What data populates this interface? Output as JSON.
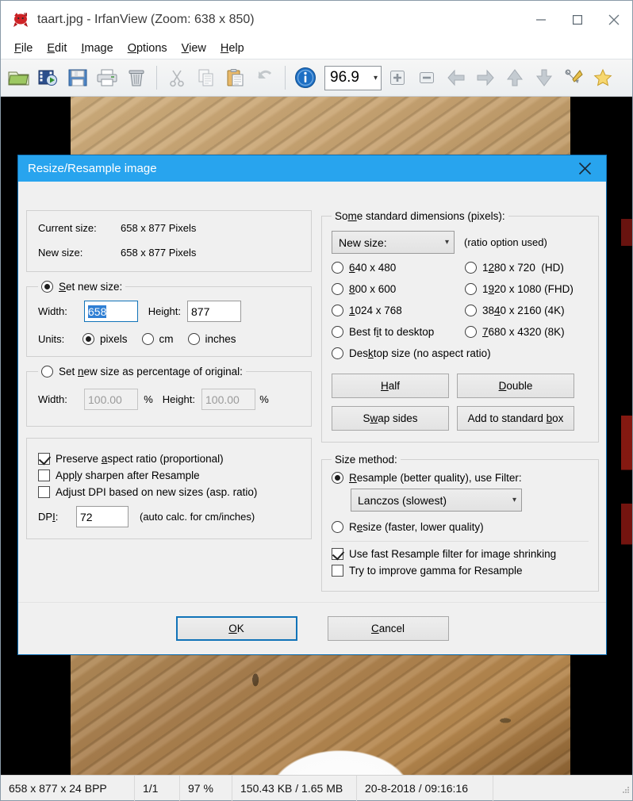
{
  "window": {
    "title": "taart.jpg - IrfanView (Zoom: 638 x 850)",
    "app_icon": "irfanview-red-cat-icon",
    "minimize_label": "—",
    "maximize_label": "□",
    "close_label": "✕"
  },
  "menubar": [
    {
      "name": "file",
      "label": "File",
      "accel": "F"
    },
    {
      "name": "edit",
      "label": "Edit",
      "accel": "E"
    },
    {
      "name": "image",
      "label": "Image",
      "accel": "I"
    },
    {
      "name": "options",
      "label": "Options",
      "accel": "O"
    },
    {
      "name": "view",
      "label": "View",
      "accel": "V"
    },
    {
      "name": "help",
      "label": "Help",
      "accel": "H"
    }
  ],
  "toolbar": {
    "buttons": [
      {
        "name": "open-icon",
        "title": "Open"
      },
      {
        "name": "slideshow-icon",
        "title": "Slideshow"
      },
      {
        "name": "save-icon",
        "title": "Save as"
      },
      {
        "name": "print-icon",
        "title": "Print"
      },
      {
        "name": "delete-icon",
        "title": "Delete"
      },
      {
        "name": "cut-icon",
        "title": "Cut"
      },
      {
        "name": "copy-icon",
        "title": "Copy"
      },
      {
        "name": "paste-icon",
        "title": "Paste"
      },
      {
        "name": "undo-icon",
        "title": "Undo"
      },
      {
        "name": "info-icon",
        "title": "Information"
      }
    ],
    "zoom_value": "96.9",
    "buttons_right": [
      {
        "name": "zoom-in-icon",
        "title": "Zoom in"
      },
      {
        "name": "zoom-out-icon",
        "title": "Zoom out"
      },
      {
        "name": "previous-icon",
        "title": "Previous"
      },
      {
        "name": "next-icon",
        "title": "Next"
      },
      {
        "name": "first-icon",
        "title": "First"
      },
      {
        "name": "last-icon",
        "title": "Last"
      },
      {
        "name": "settings-icon",
        "title": "Properties"
      },
      {
        "name": "favorites-icon",
        "title": "Favorites"
      }
    ]
  },
  "statusbar": {
    "dimensions": "658 x 877 x 24 BPP",
    "index": "1/1",
    "zoom": "97 %",
    "filesize": "150.43 KB / 1.65 MB",
    "datetime": "20-8-2018 / 09:16:16"
  },
  "dialog": {
    "title": "Resize/Resample image",
    "close_label": "✕",
    "current_size_label": "Current size:",
    "current_size_value": "658  x  877  Pixels",
    "new_size_label": "New size:",
    "new_size_value": "658  x  877  Pixels",
    "set_new_size": {
      "legend": "Set new size:",
      "legend_accel": "S",
      "selected": true,
      "width_label": "Width:",
      "width_value": "658",
      "height_label": "Height:",
      "height_value": "877",
      "units_label": "Units:",
      "units": [
        {
          "label": "pixels",
          "selected": true
        },
        {
          "label": "cm",
          "selected": false
        },
        {
          "label": "inches",
          "selected": false
        }
      ]
    },
    "set_percentage": {
      "legend": "Set new size as percentage of original:",
      "legend_accel": "n",
      "selected": false,
      "width_label": "Width:",
      "width_value": "100.00",
      "width_unit": "%",
      "height_label": "Height:",
      "height_value": "100.00",
      "height_unit": "%"
    },
    "options": {
      "preserve_aspect": {
        "label": "Preserve aspect ratio (proportional)",
        "checked": true
      },
      "apply_sharpen": {
        "label": "Apply sharpen after Resample",
        "checked": false
      },
      "adjust_dpi": {
        "label": "Adjust DPI based on new sizes (asp. ratio)",
        "checked": false
      },
      "dpi_label": "DPI:",
      "dpi_value": "72",
      "dpi_hint": "(auto calc. for cm/inches)"
    },
    "standard": {
      "legend": "Some standard dimensions (pixels):",
      "combo_value": "New size:",
      "combo_hint": "(ratio option used)",
      "radios": [
        {
          "label": "640 x 480",
          "selected": false
        },
        {
          "label": "1280 x 720   (HD)",
          "selected": false
        },
        {
          "label": "800 x 600",
          "selected": false
        },
        {
          "label": "1920 x 1080 (FHD)",
          "selected": false
        },
        {
          "label": "1024 x 768",
          "selected": false
        },
        {
          "label": "3840 x 2160 (4K)",
          "selected": false
        },
        {
          "label": "Best fit to desktop",
          "selected": false
        },
        {
          "label": "7680 x 4320 (8K)",
          "selected": false
        },
        {
          "label": "Desktop size (no aspect ratio)",
          "selected": false
        }
      ],
      "buttons": [
        {
          "label": "Half",
          "name": "half-button"
        },
        {
          "label": "Double",
          "name": "double-button"
        },
        {
          "label": "Swap sides",
          "name": "swap-sides-button"
        },
        {
          "label": "Add to standard box",
          "name": "add-to-standard-box-button"
        }
      ]
    },
    "size_method": {
      "legend": "Size method:",
      "resample": {
        "label": "Resample (better quality), use Filter:",
        "selected": true
      },
      "filter_value": "Lanczos (slowest)",
      "resize": {
        "label": "Resize (faster, lower quality)",
        "selected": false
      },
      "fast_filter": {
        "label": "Use fast Resample filter for image shrinking",
        "checked": true
      },
      "gamma": {
        "label": "Try to improve gamma for Resample",
        "checked": false
      }
    },
    "ok_label": "OK",
    "cancel_label": "Cancel"
  },
  "colors": {
    "dialog_titlebar": "#28a4ee",
    "accent": "#1173b8",
    "selection": "#2f7fd4",
    "chrome": "#f0f0f0"
  }
}
